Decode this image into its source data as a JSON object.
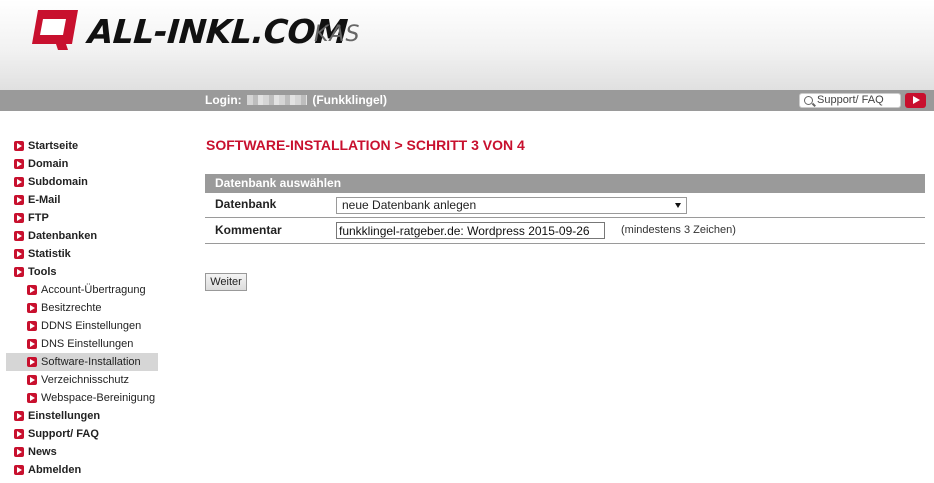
{
  "header": {
    "logo_text": "ALL-INKL.COM",
    "logo_suffix": "KAS"
  },
  "topbar": {
    "login_label": "Login:",
    "login_account": "(Funkklingel)",
    "support_label": "Support/ FAQ"
  },
  "sidebar": {
    "items": [
      {
        "label": "Startseite"
      },
      {
        "label": "Domain"
      },
      {
        "label": "Subdomain"
      },
      {
        "label": "E-Mail"
      },
      {
        "label": "FTP"
      },
      {
        "label": "Datenbanken"
      },
      {
        "label": "Statistik"
      },
      {
        "label": "Tools"
      },
      {
        "label": "Account-Übertragung"
      },
      {
        "label": "Besitzrechte"
      },
      {
        "label": "DDNS Einstellungen"
      },
      {
        "label": "DNS Einstellungen"
      },
      {
        "label": "Software-Installation"
      },
      {
        "label": "Verzeichnisschutz"
      },
      {
        "label": "Webspace-Bereinigung"
      },
      {
        "label": "Einstellungen"
      },
      {
        "label": "Support/ FAQ"
      },
      {
        "label": "News"
      },
      {
        "label": "Abmelden"
      }
    ]
  },
  "main": {
    "title": "SOFTWARE-INSTALLATION > SCHRITT 3 VON 4",
    "section_title": "Datenbank auswählen",
    "datenbank_label": "Datenbank",
    "datenbank_value": "neue Datenbank anlegen",
    "kommentar_label": "Kommentar",
    "kommentar_value": "funkklingel-ratgeber.de: Wordpress 2015-09-26",
    "kommentar_hint": "(mindestens 3 Zeichen)",
    "submit_label": "Weiter"
  },
  "colors": {
    "brand_red": "#c8102e",
    "bar_gray": "#9a9a9a",
    "active_bg": "#d6d6d6"
  }
}
